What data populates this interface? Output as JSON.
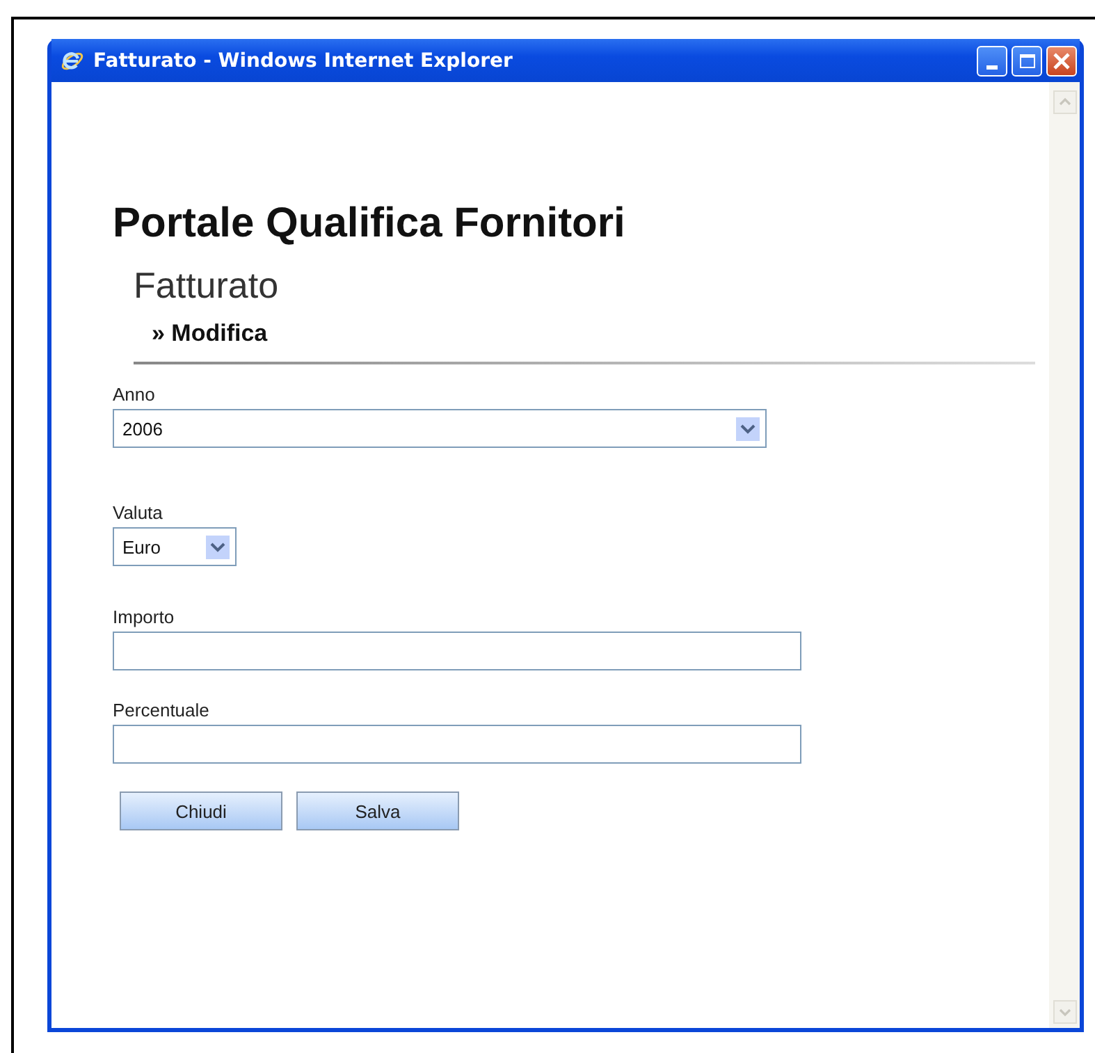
{
  "window": {
    "title": "Fatturato - Windows Internet Explorer"
  },
  "page": {
    "heading": "Portale Qualifica Fornitori",
    "subtitle": "Fatturato",
    "breadcrumb": "» Modifica"
  },
  "fields": [
    {
      "kind": "select",
      "label": "Anno",
      "value": "2006"
    },
    {
      "kind": "compact_select",
      "label": "Valuta",
      "value": "Euro"
    },
    {
      "kind": "text",
      "label": "Importo"
    },
    {
      "kind": "text",
      "label": "Percentuale"
    }
  ],
  "buttons": [
    "Chiudi",
    "Salva"
  ]
}
